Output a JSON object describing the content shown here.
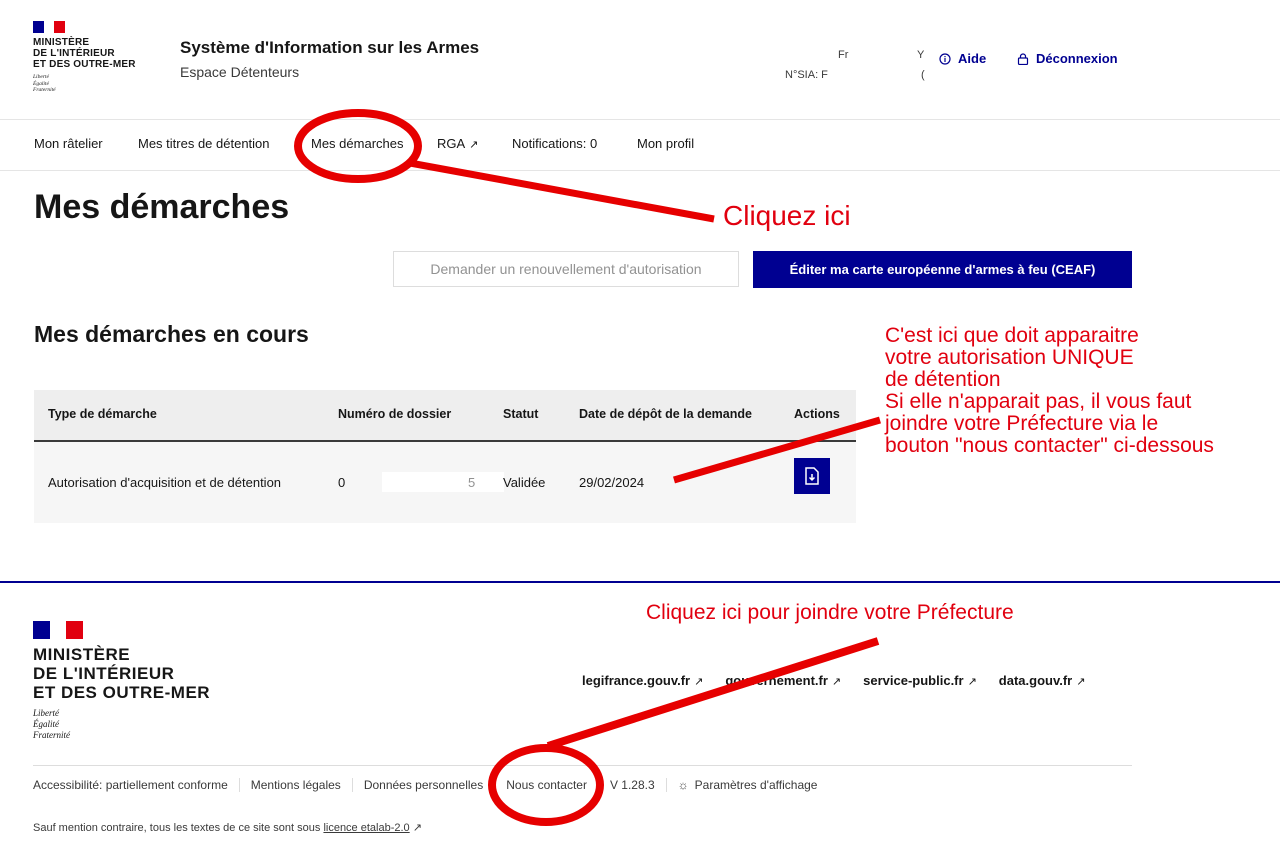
{
  "header": {
    "ministry_lines": [
      "MINISTÈRE",
      "DE L'INTÉRIEUR",
      "ET DES OUTRE-MER"
    ],
    "motto_lines": [
      "Liberté",
      "Égalité",
      "Fraternité"
    ],
    "service_title": "Système d'Information sur les Armes",
    "service_tagline": "Espace Détenteurs",
    "user_name": "Fr",
    "user_sia": "N°SIA: F",
    "user_y": "Y",
    "user_y2": "(",
    "help_label": "Aide",
    "logout_label": "Déconnexion"
  },
  "nav": {
    "items": [
      {
        "label": "Mon râtelier"
      },
      {
        "label": "Mes titres de détention"
      },
      {
        "label": "Mes démarches"
      },
      {
        "label": "RGA",
        "external": true
      },
      {
        "label": "Notifications: 0"
      },
      {
        "label": "Mon profil"
      }
    ]
  },
  "main": {
    "title": "Mes démarches",
    "renew_button": "Demander un renouvellement d'autorisation",
    "ceaf_button": "Éditer ma carte européenne d'armes à feu (CEAF)",
    "section_title": "Mes démarches en cours",
    "table": {
      "headers": [
        "Type de démarche",
        "Numéro de dossier",
        "Statut",
        "Date de dépôt de la demande",
        "Actions"
      ],
      "rows": [
        {
          "type": "Autorisation d'acquisition et de détention",
          "dossier_start": "0",
          "dossier_end": "5",
          "statut": "Validée",
          "date": "29/02/2024"
        }
      ]
    }
  },
  "footer": {
    "ministry_lines": [
      "MINISTÈRE",
      "DE L'INTÉRIEUR",
      "ET DES OUTRE-MER"
    ],
    "motto_lines": [
      "Liberté",
      "Égalité",
      "Fraternité"
    ],
    "external_links": [
      "legifrance.gouv.fr",
      "gouvernement.fr",
      "service-public.fr",
      "data.gouv.fr"
    ],
    "bottom_links": [
      "Accessibilité: partiellement conforme",
      "Mentions légales",
      "Données personnelles",
      "Nous contacter",
      "V 1.28.3",
      "Paramètres d'affichage"
    ],
    "licence_text": "Sauf mention contraire, tous les textes de ce site sont sous",
    "licence_link": "licence etalab-2.0"
  },
  "annotations": {
    "click_here": "Cliquez ici",
    "unique_lines": [
      "C'est ici que doit apparaitre",
      "votre autorisation UNIQUE",
      "de détention",
      "Si elle n'apparait pas, il vous faut",
      "joindre votre Préfecture via le",
      "bouton \"nous contacter\" ci-dessous"
    ],
    "contact_prefecture": "Cliquez ici pour joindre votre Préfecture",
    "color": "#e1000f"
  },
  "colors": {
    "brand_blue": "#000091",
    "marianne_red": "#e1000f"
  }
}
